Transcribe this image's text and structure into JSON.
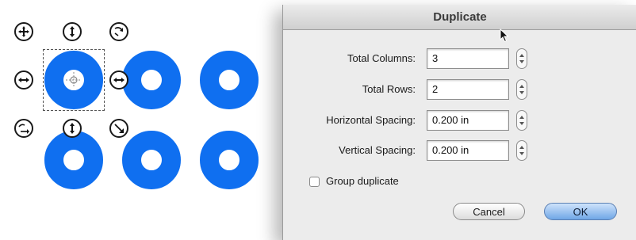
{
  "dialog": {
    "title": "Duplicate",
    "fields": [
      {
        "label": "Total Columns:",
        "value": "3"
      },
      {
        "label": "Total Rows:",
        "value": "2"
      },
      {
        "label": "Horizontal Spacing:",
        "value": "0.200 in"
      },
      {
        "label": "Vertical Spacing:",
        "value": "0.200 in"
      }
    ],
    "group_duplicate": {
      "label": "Group duplicate",
      "checked": false
    },
    "buttons": {
      "cancel": "Cancel",
      "ok": "OK"
    }
  },
  "canvas": {
    "ring_color": "#0f6ff0",
    "ring_count": 6,
    "selected_ring": 1,
    "handles": [
      "move-icon",
      "resize-vertical-icon",
      "rotate-icon",
      "resize-horizontal-icon",
      "resize-horizontal-icon",
      "rotate-icon",
      "resize-vertical-icon",
      "resize-diagonal-icon"
    ]
  }
}
